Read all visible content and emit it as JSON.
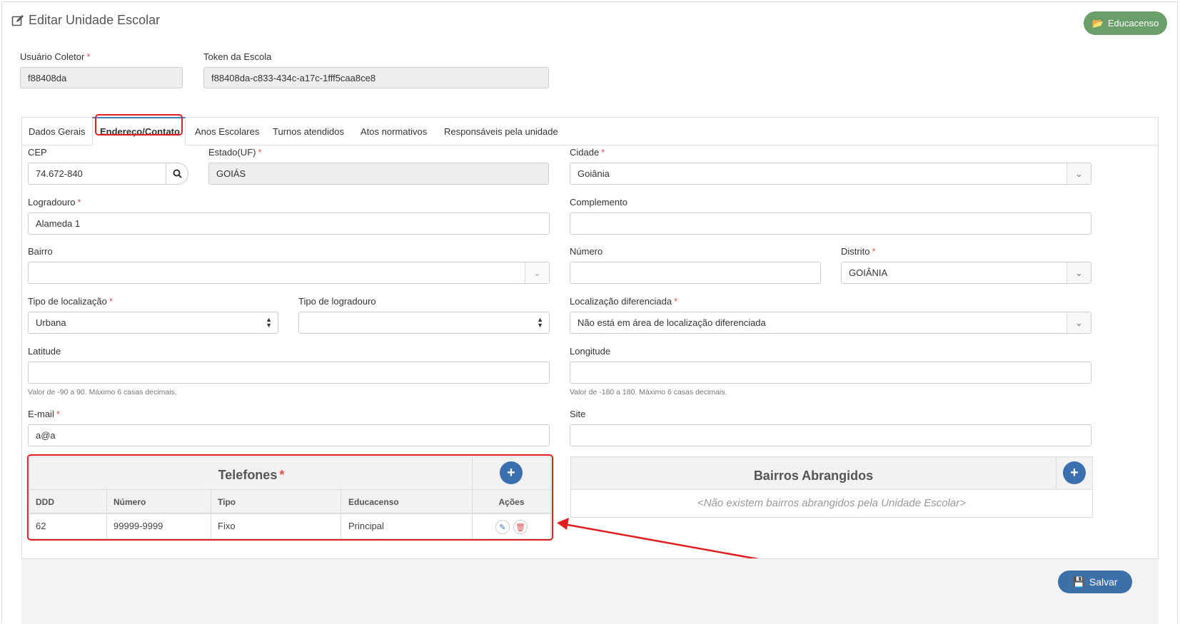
{
  "header": {
    "title": "Editar Unidade Escolar",
    "educacenso_button": "Educacenso"
  },
  "top_fields": {
    "usuario_coletor": {
      "label": "Usuário Coletor",
      "value": "f88408da"
    },
    "token_escola": {
      "label": "Token da Escola",
      "value": "f88408da-c833-434c-a17c-1fff5caa8ce8"
    }
  },
  "tabs": [
    {
      "label": "Dados Gerais"
    },
    {
      "label": "Endereço/Contato",
      "active": true
    },
    {
      "label": "Anos Escolares"
    },
    {
      "label": "Turnos atendidos"
    },
    {
      "label": "Atos normativos"
    },
    {
      "label": "Responsáveis pela unidade"
    }
  ],
  "form": {
    "cep": {
      "label": "CEP",
      "value": "74.672-840"
    },
    "estado": {
      "label": "Estado(UF)",
      "value": "GOIÁS"
    },
    "cidade": {
      "label": "Cidade",
      "value": "Goiânia"
    },
    "logradouro": {
      "label": "Logradouro",
      "value": "Alameda 1"
    },
    "complemento": {
      "label": "Complemento",
      "value": ""
    },
    "bairro": {
      "label": "Bairro",
      "value": ""
    },
    "numero": {
      "label": "Número",
      "value": ""
    },
    "distrito": {
      "label": "Distrito",
      "value": "GOIÂNIA"
    },
    "tipo_localizacao": {
      "label": "Tipo de localização",
      "value": "Urbana"
    },
    "tipo_logradouro": {
      "label": "Tipo de logradouro",
      "value": ""
    },
    "localizacao_diferenciada": {
      "label": "Localização diferenciada",
      "value": "Não está em área de localização diferenciada"
    },
    "latitude": {
      "label": "Latitude",
      "value": "",
      "help": "Valor de -90 a 90. Máximo 6 casas decimais."
    },
    "longitude": {
      "label": "Longitude",
      "value": "",
      "help": "Valor de -180 a 180. Máximo 6 casas decimais."
    },
    "email": {
      "label": "E-mail",
      "value": "a@a"
    },
    "site": {
      "label": "Site",
      "value": ""
    }
  },
  "telefones": {
    "title": "Telefones",
    "columns": [
      "DDD",
      "Número",
      "Tipo",
      "Educacenso",
      "Ações"
    ],
    "rows": [
      {
        "ddd": "62",
        "numero": "99999-9999",
        "tipo": "Fixo",
        "educacenso": "Principal"
      }
    ]
  },
  "bairros": {
    "title": "Bairros Abrangidos",
    "empty": "<Não existem bairros abrangidos pela Unidade Escolar>"
  },
  "footer": {
    "save_button": "Salvar"
  },
  "required_mark": "*",
  "colors": {
    "primary": "#3d6fa8",
    "success": "#6a9f6a",
    "highlight": "#e02020",
    "required": "#d9534f"
  }
}
